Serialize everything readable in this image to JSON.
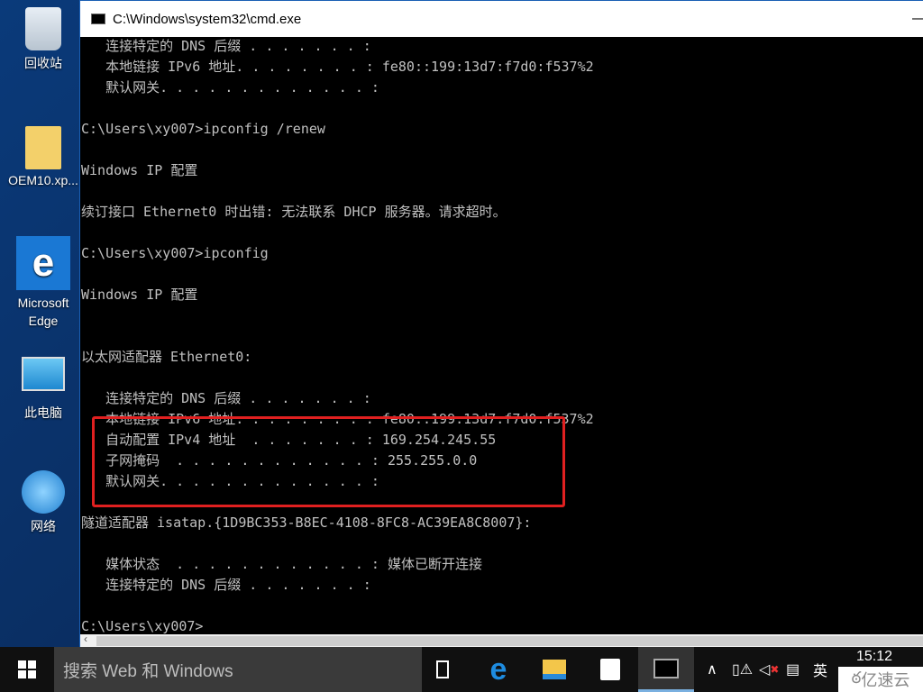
{
  "desktop": {
    "icons": [
      {
        "label": "回收站",
        "icon": "recycle-bin-icon"
      },
      {
        "label": "OEM10.xp...",
        "icon": "folder-icon"
      },
      {
        "label": "Microsoft Edge",
        "icon": "edge-icon"
      },
      {
        "label": "此电脑",
        "icon": "computer-icon"
      },
      {
        "label": "网络",
        "icon": "network-icon"
      }
    ]
  },
  "window": {
    "title": "C:\\Windows\\system32\\cmd.exe",
    "minimize": "—",
    "maximize": "☐"
  },
  "terminal": {
    "lines": [
      "   连接特定的 DNS 后缀 . . . . . . . :",
      "   本地链接 IPv6 地址. . . . . . . . : fe80::199:13d7:f7d0:f537%2",
      "   默认网关. . . . . . . . . . . . . :",
      "",
      "C:\\Users\\xy007>ipconfig /renew",
      "",
      "Windows IP 配置",
      "",
      "续订接口 Ethernet0 时出错: 无法联系 DHCP 服务器。请求超时。",
      "",
      "C:\\Users\\xy007>ipconfig",
      "",
      "Windows IP 配置",
      "",
      "",
      "以太网适配器 Ethernet0:",
      "",
      "   连接特定的 DNS 后缀 . . . . . . . :",
      "   本地链接 IPv6 地址. . . . . . . . : fe80::199:13d7:f7d0:f537%2",
      "   自动配置 IPv4 地址  . . . . . . . : 169.254.245.55",
      "   子网掩码  . . . . . . . . . . . . : 255.255.0.0",
      "   默认网关. . . . . . . . . . . . . :",
      "",
      "隧道适配器 isatap.{1D9BC353-B8EC-4108-8FC8-AC39EA8C8007}:",
      "",
      "   媒体状态  . . . . . . . . . . . . : 媒体已断开连接",
      "   连接特定的 DNS 后缀 . . . . . . . :",
      "",
      "C:\\Users\\xy007>"
    ]
  },
  "highlight_color": "#e02020",
  "taskbar": {
    "search_placeholder": "搜索 Web 和 Windows",
    "ime": "英",
    "time": "15:12",
    "watermark": "亿速云"
  }
}
